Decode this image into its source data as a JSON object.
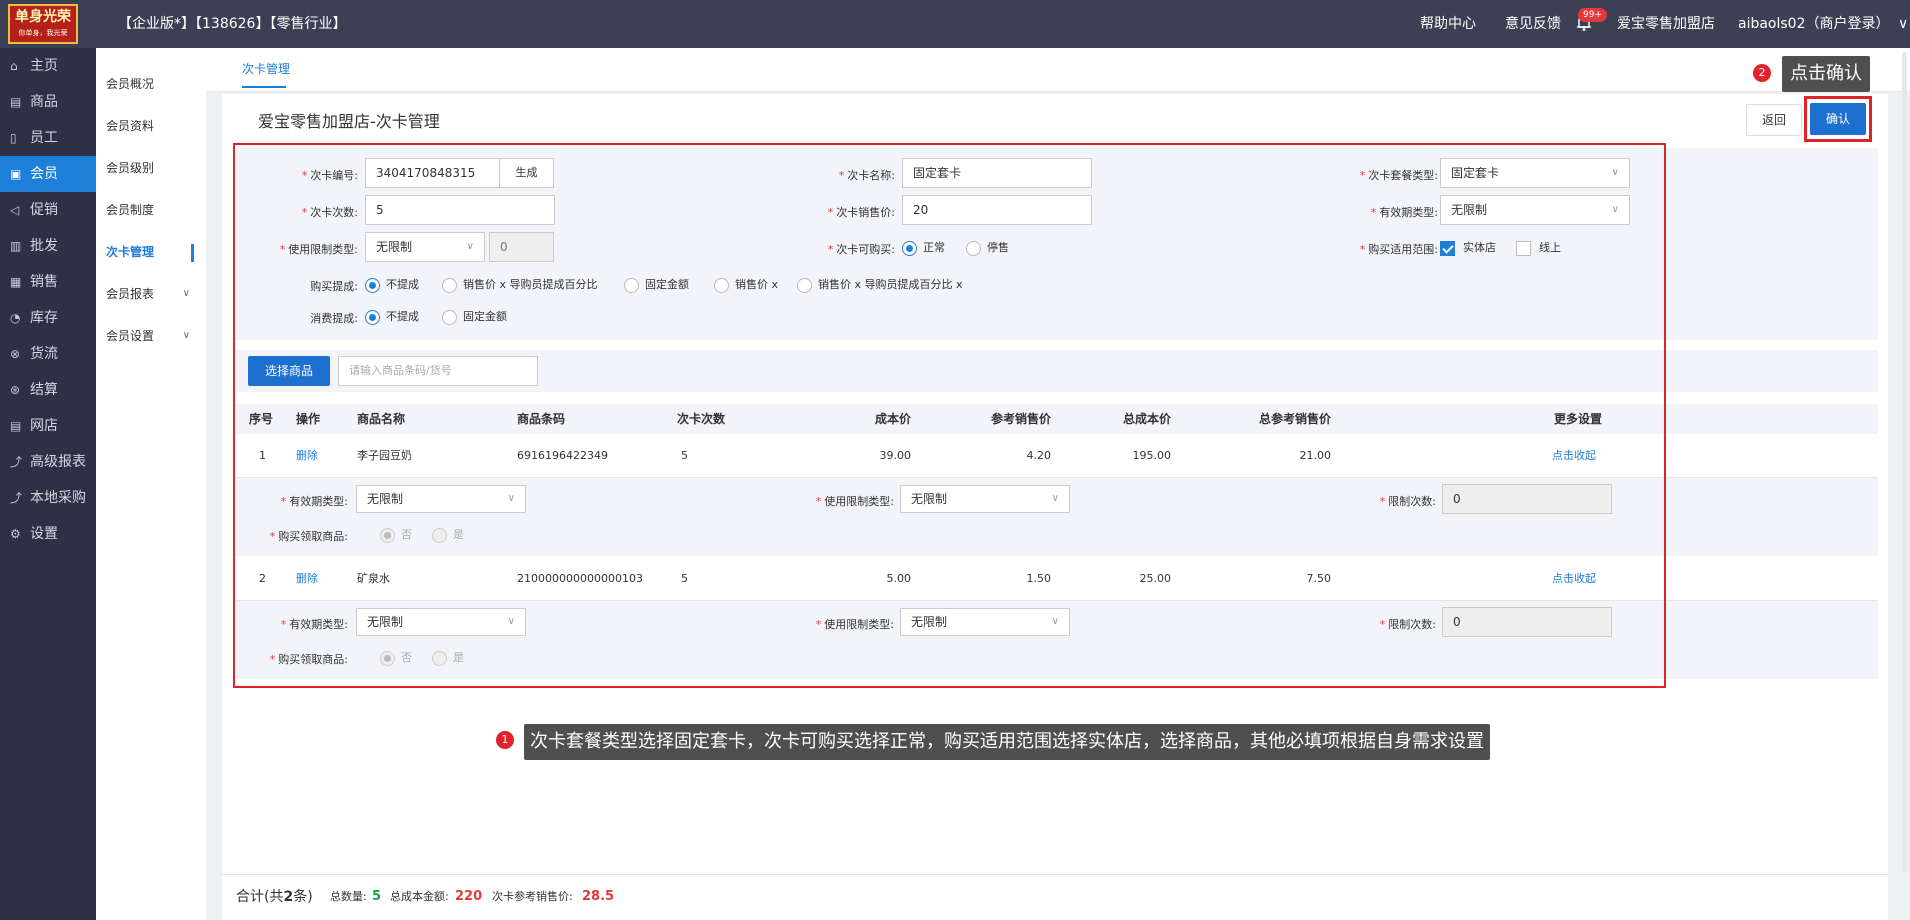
{
  "topbar": {
    "logo_main": "单身光荣",
    "logo_sub": "你单身，我光荣",
    "edition": "【企业版*】【138626】【零售行业】",
    "help": "帮助中心",
    "feedback": "意见反馈",
    "badge": "99+",
    "store": "爱宝零售加盟店",
    "user": "aibaols02（商户登录）",
    "user_arrow": "∨"
  },
  "sidebar": [
    {
      "label": "主页",
      "icon": "home-icon",
      "glyph": "⌂"
    },
    {
      "label": "商品",
      "icon": "goods-icon",
      "glyph": "▤"
    },
    {
      "label": "员工",
      "icon": "staff-icon",
      "glyph": "▯"
    },
    {
      "label": "会员",
      "icon": "member-icon",
      "glyph": "▣",
      "active": true
    },
    {
      "label": "促销",
      "icon": "promo-icon",
      "glyph": "◁"
    },
    {
      "label": "批发",
      "icon": "wholesale-icon",
      "glyph": "▥"
    },
    {
      "label": "销售",
      "icon": "sales-icon",
      "glyph": "▦"
    },
    {
      "label": "库存",
      "icon": "stock-icon",
      "glyph": "◔"
    },
    {
      "label": "货流",
      "icon": "flow-icon",
      "glyph": "⊗"
    },
    {
      "label": "结算",
      "icon": "settle-icon",
      "glyph": "⊛"
    },
    {
      "label": "网店",
      "icon": "shop-icon",
      "glyph": "▤"
    },
    {
      "label": "高级报表",
      "icon": "report-icon",
      "glyph": "⤴"
    },
    {
      "label": "本地采购",
      "icon": "purchase-icon",
      "glyph": "⤴"
    },
    {
      "label": "设置",
      "icon": "settings-icon",
      "glyph": "⚙"
    }
  ],
  "subnav": [
    {
      "label": "会员概况"
    },
    {
      "label": "会员资料"
    },
    {
      "label": "会员级别"
    },
    {
      "label": "会员制度"
    },
    {
      "label": "次卡管理",
      "active": true
    },
    {
      "label": "会员报表",
      "chevron": "∨"
    },
    {
      "label": "会员设置",
      "chevron": "∨"
    }
  ],
  "tab": "次卡管理",
  "panel_title": "爱宝零售加盟店-次卡管理",
  "buttons": {
    "back": "返回",
    "confirm": "确认",
    "select_goods": "选择商品",
    "generate": "生成"
  },
  "tips": {
    "num1": "1",
    "text1": "次卡套餐类型选择固定套卡，次卡可购买选择正常，购买适用范围选择实体店，选择商品，其他必填项根据自身需求设置",
    "num2": "2",
    "text2": "点击确认"
  },
  "form": {
    "req": "*",
    "dd": "∨",
    "card_no_label": "次卡编号:",
    "card_no": "3404170848315",
    "card_name_label": "次卡名称:",
    "card_name": "固定套卡",
    "package_type_label": "次卡套餐类型:",
    "package_type": "固定套卡",
    "times_label": "次卡次数:",
    "times": "5",
    "price_label": "次卡销售价:",
    "price": "20",
    "valid_type_label": "有效期类型:",
    "valid_type": "无限制",
    "limit_type_label": "使用限制类型:",
    "limit_type": "无限制",
    "limit_value": "0",
    "buyable_label": "次卡可购买:",
    "buyable_options": [
      "正常",
      "停售"
    ],
    "scope_label": "购买适用范围:",
    "scope_options": [
      "实体店",
      "线上"
    ],
    "buy_commission_label": "购买提成:",
    "buy_commission_options": [
      "不提成",
      "销售价 x 导购员提成百分比",
      "固定金额",
      "销售价 x",
      "销售价 x 导购员提成百分比 x"
    ],
    "consume_commission_label": "消费提成:",
    "consume_commission_options": [
      "不提成",
      "固定金额"
    ]
  },
  "search_placeholder": "请输入商品条码/货号",
  "table": {
    "headers": [
      "序号",
      "操作",
      "商品名称",
      "商品条码",
      "次卡次数",
      "成本价",
      "参考销售价",
      "总成本价",
      "总参考销售价",
      "更多设置"
    ],
    "rows": [
      {
        "no": "1",
        "op": "删除",
        "name": "李子园豆奶",
        "barcode": "6916196422349",
        "times": "5",
        "cost": "39.00",
        "ref_price": "4.20",
        "total_cost": "195.00",
        "total_ref": "21.00",
        "more": "点击收起"
      },
      {
        "no": "2",
        "op": "删除",
        "name": "矿泉水",
        "barcode": "210000000000000103",
        "times": "5",
        "cost": "5.00",
        "ref_price": "1.50",
        "total_cost": "25.00",
        "total_ref": "7.50",
        "more": "点击收起"
      }
    ],
    "sub_labels": {
      "valid": "有效期类型:",
      "limit": "使用限制类型:",
      "count": "限制次数:",
      "receive": "购买领取商品:"
    },
    "sub_values": {
      "valid": "无限制",
      "limit": "无限制",
      "count": "0",
      "no": "否",
      "yes": "是"
    }
  },
  "footer": {
    "total_label": "合计(共",
    "total_count": "2",
    "total_unit": "条)",
    "qty_label": "总数量:",
    "qty": "5",
    "cost_label": "总成本金额:",
    "cost": "220",
    "ref_label": "次卡参考销售价:",
    "ref": "28.5"
  },
  "colors": {
    "accent": "#1d7fd9",
    "highlight": "#e0232b",
    "sidebar": "#2c3145",
    "topbar": "#3c4055"
  }
}
